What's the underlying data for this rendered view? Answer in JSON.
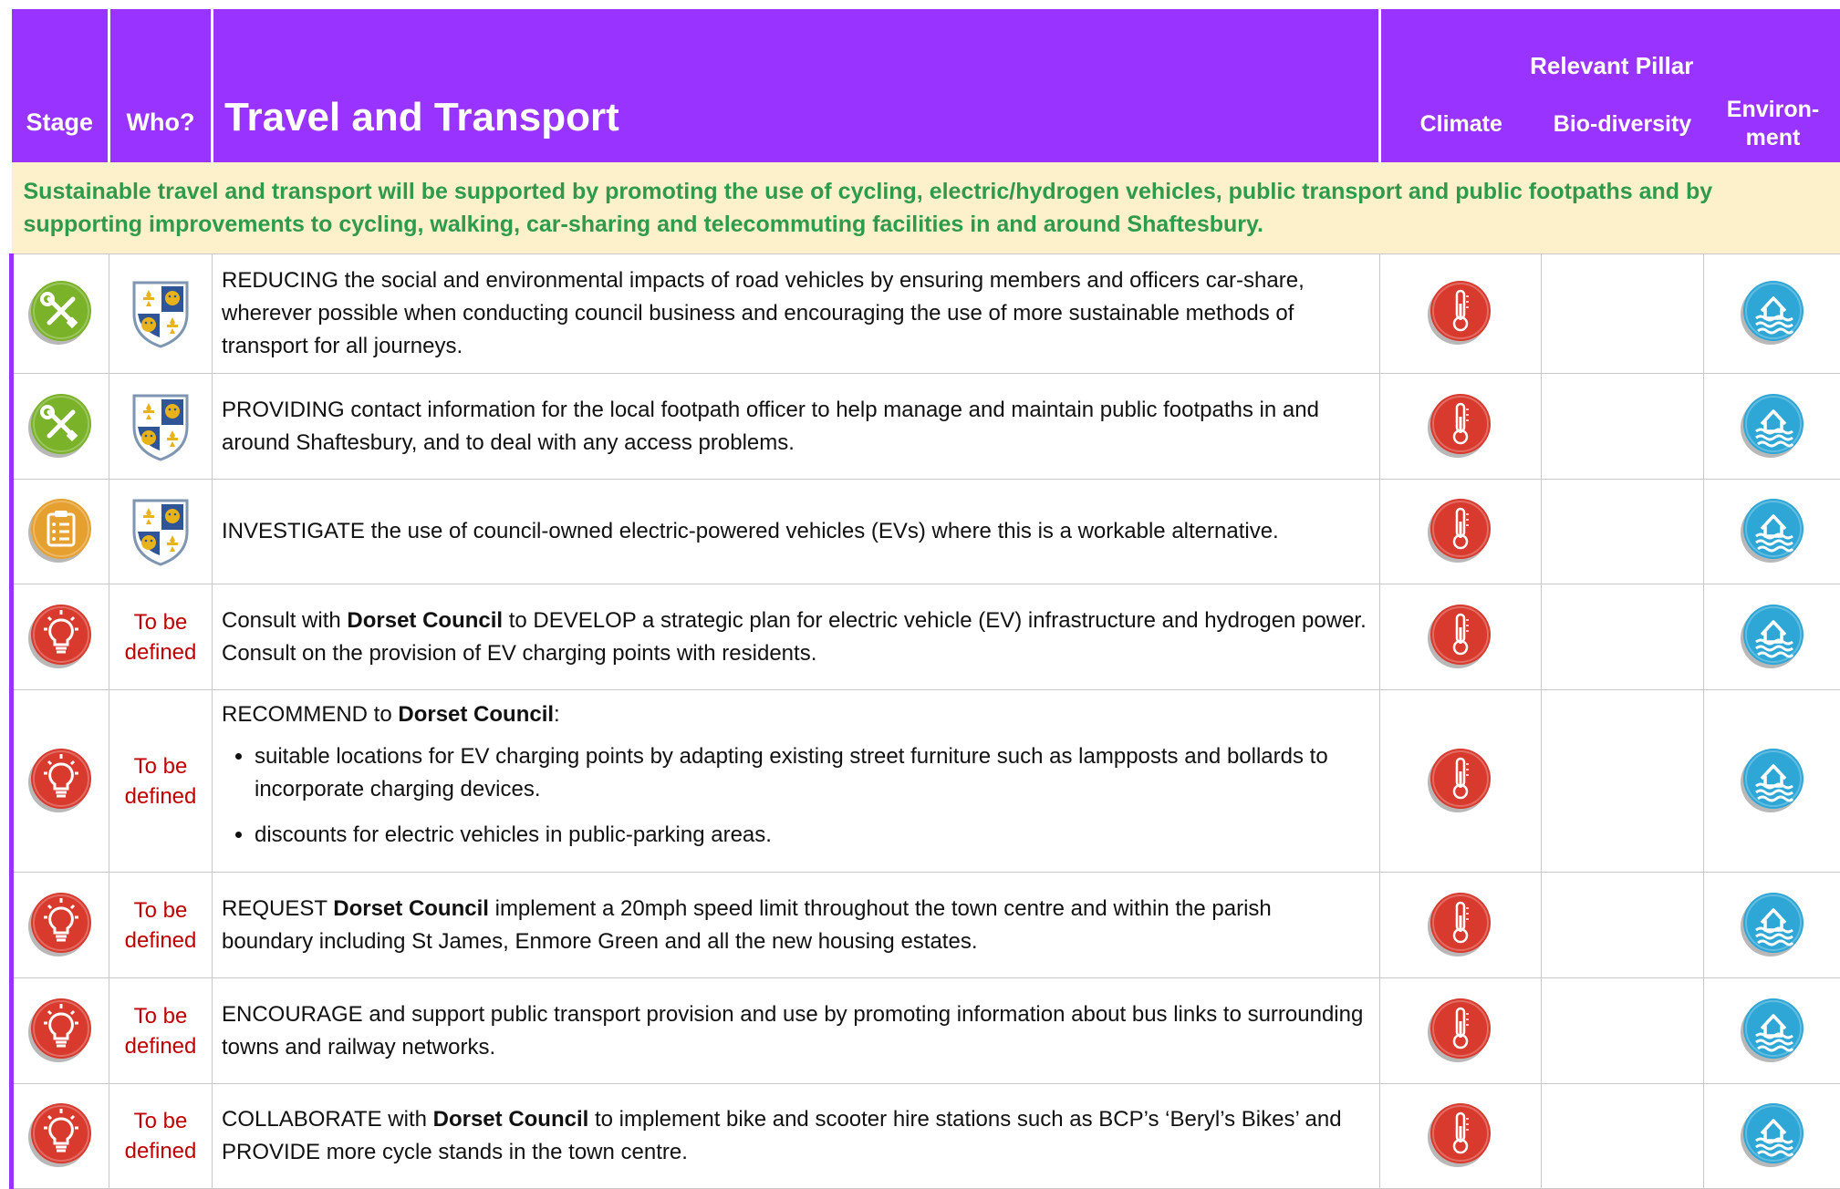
{
  "header": {
    "stage": "Stage",
    "who": "Who?",
    "title": "Travel and Transport",
    "pillar_group": "Relevant Pillar",
    "pillars": [
      "Climate",
      "Bio-diversity",
      "Environ-ment"
    ]
  },
  "intro": "Sustainable travel and transport will be supported by promoting the use of cycling, electric/hydrogen vehicles, public transport and public footpaths and by supporting improvements to cycling, walking, car-sharing and telecommuting facilities in and around Shaftesbury.",
  "colors": {
    "header_bg": "#9933ff",
    "intro_bg": "#fdf1cc",
    "intro_text": "#2e9a4a",
    "tbd_text": "#c00000",
    "stage_tools": "#7ab229",
    "stage_plan": "#e6a030",
    "stage_idea": "#d83a2e",
    "climate_icon": "#d83a2e",
    "environment_icon": "#2ea6d6"
  },
  "who_tbd": "To be defined",
  "rows": [
    {
      "stage_icon": "tools-icon",
      "who_icon": "council-crest-icon",
      "text_a": "REDUCING the social and environmental impacts of road vehicles by ensuring members and officers car-share, wherever possible when conducting council business  and encouraging the use of more sustainable methods of transport for all journeys.",
      "climate": "thermometer-icon",
      "environment": "flood-house-icon"
    },
    {
      "stage_icon": "tools-icon",
      "who_icon": "council-crest-icon",
      "text_a": "PROVIDING contact information for the local footpath officer to help manage and maintain public footpaths in and around Shaftesbury, and to deal with any access problems.",
      "climate": "thermometer-icon",
      "environment": "flood-house-icon"
    },
    {
      "stage_icon": "clipboard-icon",
      "who_icon": "council-crest-icon",
      "text_a": "INVESTIGATE the use of council-owned electric-powered vehicles (EVs) where this is a workable alternative.",
      "climate": "thermometer-icon",
      "environment": "flood-house-icon"
    },
    {
      "stage_icon": "lightbulb-icon",
      "who": "To be defined",
      "text_a": "Consult with ",
      "bold": "Dorset Council",
      "text_b": " to DEVELOP a strategic plan for electric vehicle (EV) infrastructure and hydrogen power. Consult on the provision of EV charging points with residents.",
      "climate": "thermometer-icon",
      "environment": "flood-house-icon"
    },
    {
      "stage_icon": "lightbulb-icon",
      "who": "To be defined",
      "text_a": "RECOMMEND to ",
      "bold": "Dorset Council",
      "text_b": ":",
      "bullets": [
        "suitable locations for EV charging points by adapting existing street furniture such as lampposts and bollards to incorporate charging devices.",
        "discounts for electric vehicles in public-parking areas."
      ],
      "climate": "thermometer-icon",
      "environment": "flood-house-icon"
    },
    {
      "stage_icon": "lightbulb-icon",
      "who": "To be defined",
      "text_a": "REQUEST ",
      "bold": "Dorset Council",
      "text_b": " implement a 20mph speed limit throughout the town centre and within the parish boundary including St James, Enmore Green and all the new housing estates.",
      "climate": "thermometer-icon",
      "environment": "flood-house-icon"
    },
    {
      "stage_icon": "lightbulb-icon",
      "who": "To be defined",
      "text_a": "ENCOURAGE and support public transport provision and use by promoting information about bus links to surrounding towns and railway networks.",
      "climate": "thermometer-icon",
      "environment": "flood-house-icon"
    },
    {
      "stage_icon": "lightbulb-icon",
      "who": "To be defined",
      "text_a": "COLLABORATE with ",
      "bold": "Dorset Council",
      "text_b": " to implement bike and scooter hire stations such as BCP’s ‘Beryl’s Bikes’ and PROVIDE more cycle stands in the town centre.",
      "climate": "thermometer-icon",
      "environment": "flood-house-icon"
    }
  ]
}
